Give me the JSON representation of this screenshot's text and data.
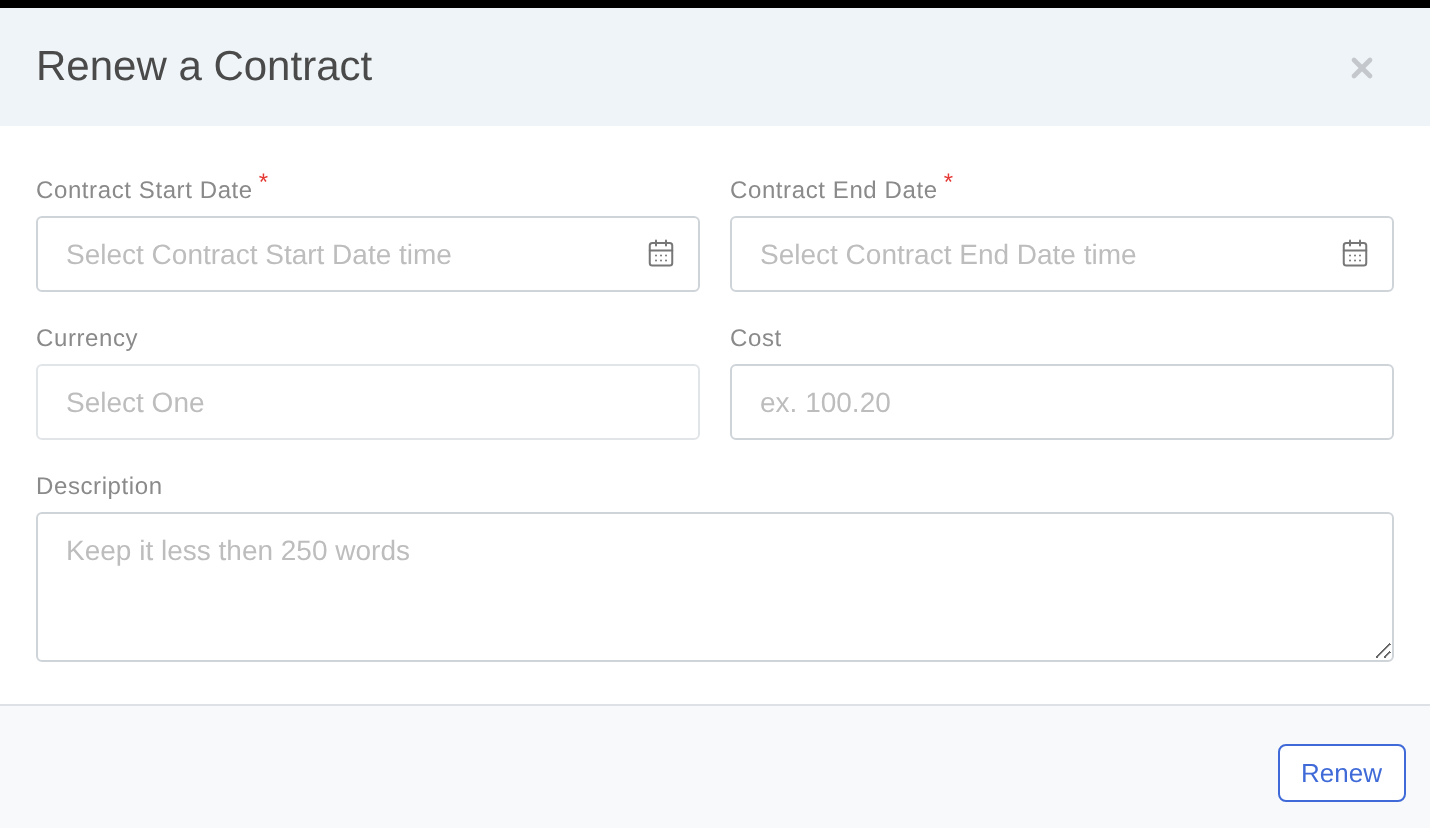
{
  "dialog": {
    "title": "Renew a Contract"
  },
  "fields": [
    {
      "label": "Contract Start Date",
      "marker": "*",
      "kind": "date",
      "placeholder": "Select Contract Start Date time"
    },
    {
      "label": "Contract End Date",
      "marker": "*",
      "kind": "date",
      "placeholder": "Select Contract End Date time"
    },
    {
      "label": "Currency",
      "kind": "select",
      "placeholder": "Select One"
    },
    {
      "label": "Cost",
      "kind": "text",
      "placeholder": "ex. 100.20"
    },
    {
      "label": "Description",
      "kind": "textarea",
      "placeholder": "Keep it less then 250 words"
    }
  ],
  "buttons": [
    {
      "label": "Renew"
    }
  ]
}
